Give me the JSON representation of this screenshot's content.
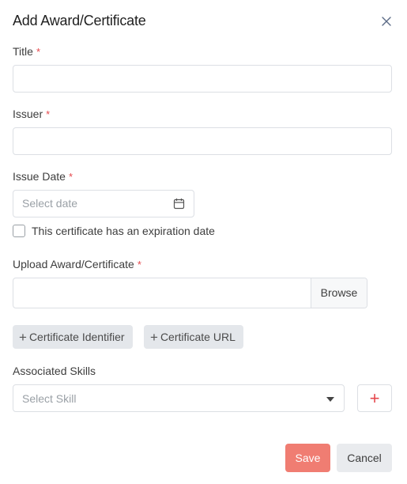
{
  "modal": {
    "title": "Add Award/Certificate",
    "close_icon": "close-icon"
  },
  "fields": {
    "title_label": "Title",
    "issuer_label": "Issuer",
    "issue_date_label": "Issue Date",
    "issue_date_placeholder": "Select date",
    "expiration_checkbox_label": "This certificate has an expiration date",
    "upload_label": "Upload Award/Certificate",
    "browse_label": "Browse",
    "required_marker": "*"
  },
  "chips": {
    "certificate_identifier": "Certificate Identifier",
    "certificate_url": "Certificate URL",
    "plus": "+"
  },
  "skills": {
    "label": "Associated Skills",
    "placeholder": "Select Skill",
    "add_symbol": "+"
  },
  "actions": {
    "save": "Save",
    "cancel": "Cancel"
  },
  "colors": {
    "required": "#e5484d",
    "save_button": "#f07d72",
    "cancel_button": "#e9ebee",
    "chip_background": "#e4e7eb"
  }
}
